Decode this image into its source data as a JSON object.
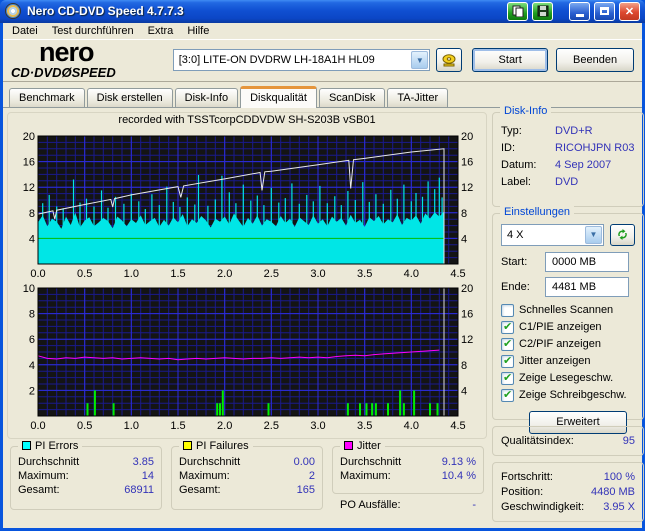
{
  "window": {
    "title": "Nero CD-DVD Speed 4.7.7.3"
  },
  "menu": {
    "items": [
      "Datei",
      "Test durchführen",
      "Extra",
      "Hilfe"
    ]
  },
  "header": {
    "logo_top": "nero",
    "logo_bottom": "CD·DVDØSPEED",
    "drive_value": "[3:0]   LITE-ON DVDRW LH-18A1H HL09",
    "start_label": "Start",
    "quit_label": "Beenden"
  },
  "tabs": {
    "items": [
      {
        "label": "Benchmark"
      },
      {
        "label": "Disk erstellen"
      },
      {
        "label": "Disk-Info"
      },
      {
        "label": "Diskqualität"
      },
      {
        "label": "ScanDisk"
      },
      {
        "label": "TA-Jitter"
      }
    ],
    "active": "Diskqualität"
  },
  "chart_annotation": "recorded with TSSTcorpCDDVDW SH-S203B  vSB01",
  "chart_data": [
    {
      "id": "quality-top-chart",
      "type": "area",
      "title": "PI Errors / speed",
      "xlim": [
        0,
        4.5
      ],
      "x_ticks": [
        0,
        0.5,
        1,
        1.5,
        2,
        2.5,
        3,
        3.5,
        4,
        4.5
      ],
      "minor_x": 0.1,
      "left_ylim": [
        0,
        20
      ],
      "left_ticks": [
        4,
        8,
        12,
        16,
        20
      ],
      "minor_y": 1,
      "right_ylim": [
        0,
        20
      ],
      "right_ticks": [
        4,
        8,
        12,
        16,
        20
      ],
      "grid": true,
      "bg": "#141414",
      "series": [
        {
          "name": "pi-errors-base",
          "type": "area",
          "scale": "left",
          "color": "#00E6E6",
          "x_start": 0,
          "x_step": 0.05,
          "values": [
            6.5,
            7.6,
            5.9,
            7.1,
            6.6,
            5.5,
            7.4,
            6.1,
            8.0,
            5.7,
            6.8,
            7.3,
            5.9,
            6.5,
            7.2,
            6.7,
            5.6,
            7.4,
            6.8,
            5.9,
            7.0,
            6.4,
            7.6,
            6.1,
            6.7,
            7.2,
            5.8,
            6.9,
            6.0,
            7.3,
            6.5,
            7.8,
            5.9,
            7.0,
            6.4,
            7.5,
            6.8,
            5.7,
            7.1,
            6.6,
            7.4,
            6.2,
            7.9,
            6.8,
            5.8,
            7.2,
            6.3,
            7.6,
            6.0,
            7.0,
            6.6,
            5.9,
            7.5,
            6.4,
            7.1,
            5.8,
            7.3,
            6.7,
            6.1,
            7.6,
            6.3,
            7.0,
            5.9,
            7.4,
            6.6,
            7.2,
            6.0,
            7.7,
            6.4,
            6.9,
            5.8,
            7.3,
            6.7,
            7.5,
            6.2,
            7.0,
            6.5,
            7.8,
            6.1,
            7.2,
            6.8,
            7.6,
            6.3,
            7.9,
            7.1,
            8.1,
            7.4,
            8.2
          ]
        },
        {
          "name": "pi-errors-spikes",
          "type": "sticks",
          "scale": "left",
          "color": "#00E6E6",
          "width": 1.2,
          "points": [
            [
              0.05,
              9.5
            ],
            [
              0.12,
              10.8
            ],
            [
              0.2,
              9.0
            ],
            [
              0.27,
              8.7
            ],
            [
              0.38,
              13.2
            ],
            [
              0.45,
              9.6
            ],
            [
              0.52,
              10.2
            ],
            [
              0.6,
              9.0
            ],
            [
              0.68,
              11.5
            ],
            [
              0.75,
              8.8
            ],
            [
              0.83,
              10.5
            ],
            [
              0.92,
              9.4
            ],
            [
              1.0,
              11.0
            ],
            [
              1.08,
              9.8
            ],
            [
              1.15,
              8.6
            ],
            [
              1.22,
              10.9
            ],
            [
              1.3,
              9.2
            ],
            [
              1.38,
              12.1
            ],
            [
              1.45,
              9.7
            ],
            [
              1.52,
              8.9
            ],
            [
              1.6,
              10.4
            ],
            [
              1.68,
              9.3
            ],
            [
              1.72,
              13.9
            ],
            [
              1.82,
              9.1
            ],
            [
              1.9,
              10.1
            ],
            [
              1.97,
              13.8
            ],
            [
              2.05,
              11.2
            ],
            [
              2.12,
              9.5
            ],
            [
              2.2,
              12.4
            ],
            [
              2.28,
              9.9
            ],
            [
              2.35,
              10.7
            ],
            [
              2.42,
              9.2
            ],
            [
              2.5,
              11.9
            ],
            [
              2.58,
              9.6
            ],
            [
              2.65,
              10.3
            ],
            [
              2.72,
              12.6
            ],
            [
              2.8,
              9.4
            ],
            [
              2.88,
              10.8
            ],
            [
              2.95,
              9.8
            ],
            [
              3.02,
              12.2
            ],
            [
              3.1,
              9.5
            ],
            [
              3.18,
              10.6
            ],
            [
              3.25,
              9.2
            ],
            [
              3.32,
              11.4
            ],
            [
              3.4,
              10.0
            ],
            [
              3.48,
              12.8
            ],
            [
              3.55,
              9.7
            ],
            [
              3.62,
              10.9
            ],
            [
              3.7,
              9.4
            ],
            [
              3.78,
              11.6
            ],
            [
              3.85,
              10.2
            ],
            [
              3.92,
              12.4
            ],
            [
              4.0,
              9.8
            ],
            [
              4.05,
              11.1
            ],
            [
              4.12,
              10.5
            ],
            [
              4.18,
              12.9
            ],
            [
              4.25,
              11.7
            ],
            [
              4.3,
              13.5
            ],
            [
              4.33,
              10.4
            ]
          ]
        },
        {
          "name": "scan-speed-line",
          "type": "line",
          "scale": "right",
          "color": "#00BE00",
          "width": 1,
          "points": [
            [
              0,
              4
            ],
            [
              4.35,
              4
            ]
          ]
        },
        {
          "name": "write-speed-line",
          "type": "line",
          "scale": "right",
          "color": "#E8E8E8",
          "width": 1,
          "points": [
            [
              0,
              7.8
            ],
            [
              0.16,
              8.3
            ],
            [
              0.18,
              7.0
            ],
            [
              0.2,
              8.4
            ],
            [
              0.5,
              9.3
            ],
            [
              0.78,
              10.1
            ],
            [
              0.8,
              8.9
            ],
            [
              0.82,
              10.2
            ],
            [
              1.0,
              10.8
            ],
            [
              1.5,
              12.1
            ],
            [
              1.53,
              10.4
            ],
            [
              1.56,
              12.2
            ],
            [
              2.0,
              13.3
            ],
            [
              2.38,
              14.3
            ],
            [
              2.4,
              11.5
            ],
            [
              2.43,
              14.4
            ],
            [
              2.5,
              14.5
            ],
            [
              3.0,
              15.5
            ],
            [
              3.33,
              16.2
            ],
            [
              3.35,
              11.8
            ],
            [
              3.38,
              16.3
            ],
            [
              3.5,
              16.5
            ],
            [
              4.0,
              17.5
            ],
            [
              4.35,
              18.0
            ],
            [
              4.35,
              0
            ]
          ]
        }
      ]
    },
    {
      "id": "quality-bottom-chart",
      "type": "line",
      "title": "PI Failures / Jitter",
      "xlim": [
        0,
        4.5
      ],
      "x_ticks": [
        0,
        0.5,
        1,
        1.5,
        2,
        2.5,
        3,
        3.5,
        4,
        4.5
      ],
      "minor_x": 0.1,
      "left_ylim": [
        0,
        10
      ],
      "left_ticks": [
        2,
        4,
        6,
        8,
        10
      ],
      "minor_y": 0.5,
      "right_ylim": [
        0,
        20
      ],
      "right_ticks": [
        4,
        8,
        12,
        16,
        20
      ],
      "grid": true,
      "bg": "#141414",
      "series": [
        {
          "name": "pif-spikes",
          "type": "sticks",
          "scale": "left",
          "color": "#00EE00",
          "width": 2,
          "points": [
            [
              0.53,
              1
            ],
            [
              0.61,
              2
            ],
            [
              0.81,
              1
            ],
            [
              1.92,
              1
            ],
            [
              1.95,
              1
            ],
            [
              1.98,
              2
            ],
            [
              2.47,
              1
            ],
            [
              3.32,
              1
            ],
            [
              3.45,
              1
            ],
            [
              3.52,
              1
            ],
            [
              3.58,
              1
            ],
            [
              3.62,
              1
            ],
            [
              3.75,
              1
            ],
            [
              3.88,
              2
            ],
            [
              3.92,
              1
            ],
            [
              4.03,
              2
            ],
            [
              4.2,
              1
            ],
            [
              4.28,
              1
            ]
          ]
        },
        {
          "name": "jitter-line",
          "type": "line",
          "scale": "right",
          "color": "#FF00FF",
          "width": 1,
          "x_start": 0,
          "x_step": 0.1,
          "values": [
            9.4,
            9.0,
            8.9,
            9.1,
            9.0,
            9.2,
            9.1,
            9.0,
            9.1,
            8.9,
            9.0,
            9.1,
            9.0,
            8.9,
            9.0,
            8.8,
            8.9,
            9.0,
            8.9,
            9.0,
            9.1,
            9.0,
            8.9,
            9.0,
            9.0,
            9.1,
            9.0,
            9.1,
            9.2,
            9.1,
            9.2,
            9.1,
            9.3,
            9.4,
            9.5,
            9.4,
            9.6,
            9.7,
            9.8,
            9.9,
            10.0,
            10.1,
            10.2,
            10.3
          ]
        },
        {
          "name": "scan-end-marker",
          "type": "line",
          "scale": "left",
          "color": "#DCDCDC",
          "width": 1,
          "points": [
            [
              4.35,
              0
            ],
            [
              4.35,
              10
            ]
          ]
        }
      ]
    }
  ],
  "disk_info": {
    "title": "Disk-Info",
    "rows": [
      {
        "label": "Typ:",
        "value": "DVD+R"
      },
      {
        "label": "ID:",
        "value": "RICOHJPN R03"
      },
      {
        "label": "Datum:",
        "value": "4 Sep 2007"
      },
      {
        "label": "Label:",
        "value": "DVD"
      }
    ]
  },
  "settings": {
    "title": "Einstellungen",
    "speed_value": "4 X",
    "start_label": "Start:",
    "start_value": "0000 MB",
    "end_label": "Ende:",
    "end_value": "4481 MB",
    "checkboxes": [
      {
        "label": "Schnelles Scannen",
        "checked": false
      },
      {
        "label": "C1/PIE anzeigen",
        "checked": true
      },
      {
        "label": "C2/PIF anzeigen",
        "checked": true
      },
      {
        "label": "Jitter anzeigen",
        "checked": true
      },
      {
        "label": "Zeige Lesegeschw.",
        "checked": true
      },
      {
        "label": "Zeige Schreibgeschw.",
        "checked": true
      }
    ],
    "advanced_label": "Erweitert"
  },
  "quality": {
    "label": "Qualitätsindex:",
    "value": "95"
  },
  "progress": {
    "rows": [
      {
        "label": "Fortschritt:",
        "value": "100 %"
      },
      {
        "label": "Position:",
        "value": "4480 MB"
      },
      {
        "label": "Geschwindigkeit:",
        "value": "3.95 X"
      }
    ]
  },
  "stats": [
    {
      "title": "PI Errors",
      "color": "#00FFFF",
      "rows": [
        {
          "label": "Durchschnitt",
          "value": "3.85"
        },
        {
          "label": "Maximum:",
          "value": "14"
        },
        {
          "label": "Gesamt:",
          "value": "68911"
        }
      ]
    },
    {
      "title": "PI Failures",
      "color": "#FFFF00",
      "rows": [
        {
          "label": "Durchschnitt",
          "value": "0.00"
        },
        {
          "label": "Maximum:",
          "value": "2"
        },
        {
          "label": "Gesamt:",
          "value": "165"
        }
      ]
    },
    {
      "title": "Jitter",
      "color": "#FF00FF",
      "rows": [
        {
          "label": "Durchschnitt",
          "value": "9.13 %"
        },
        {
          "label": "Maximum:",
          "value": "10.4 %"
        }
      ],
      "extra": {
        "label": "PO Ausfälle:",
        "value": "-"
      }
    }
  ]
}
